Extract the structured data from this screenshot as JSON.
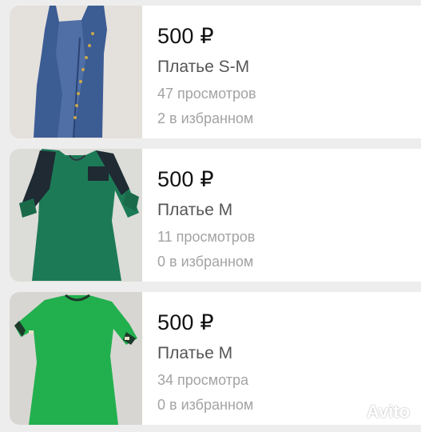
{
  "listings": [
    {
      "price": "500 ₽",
      "title": "Платье S-M",
      "views": "47 просмотров",
      "favorites": "2 в избранном",
      "photo": "denim-dress-photo"
    },
    {
      "price": "500 ₽",
      "title": "Платье M",
      "views": "11 просмотров",
      "favorites": "0 в избранном",
      "photo": "dark-green-dress-photo"
    },
    {
      "price": "500 ₽",
      "title": "Платье M",
      "views": "34 просмотра",
      "favorites": "0 в избранном",
      "photo": "green-dress-photo"
    }
  ],
  "watermark": {
    "text": "Avito"
  },
  "colors": {
    "background": "#ededed",
    "card": "#ffffff",
    "price": "#111111",
    "muted": "#a3a3a3"
  }
}
